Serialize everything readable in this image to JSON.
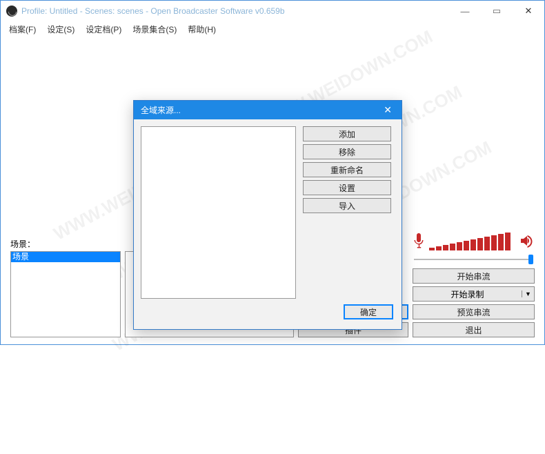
{
  "titlebar": {
    "text": "Profile: Untitled - Scenes: scenes - Open Broadcaster Software v0.659b"
  },
  "menu": {
    "items": [
      "档案(F)",
      "设定(S)",
      "设定档(P)",
      "场景集合(S)",
      "帮助(H)"
    ]
  },
  "scenes": {
    "label": "场景：",
    "items": [
      "场景"
    ]
  },
  "main_buttons": {
    "global_sources": "全域来源...",
    "plugins": "插件",
    "start_stream": "开始串流",
    "start_record": "开始录制",
    "preview_stream": "预览串流",
    "exit": "退出"
  },
  "dialog": {
    "title": "全域来源...",
    "buttons": {
      "add": "添加",
      "remove": "移除",
      "rename": "重新命名",
      "settings": "设置",
      "import": "导入"
    },
    "ok": "确定"
  },
  "audio": {
    "meter_heights": [
      4,
      6,
      8,
      10,
      12,
      14,
      16,
      18,
      20,
      22,
      24,
      26
    ]
  },
  "watermark": "WWW.WEIDOWN.COM"
}
